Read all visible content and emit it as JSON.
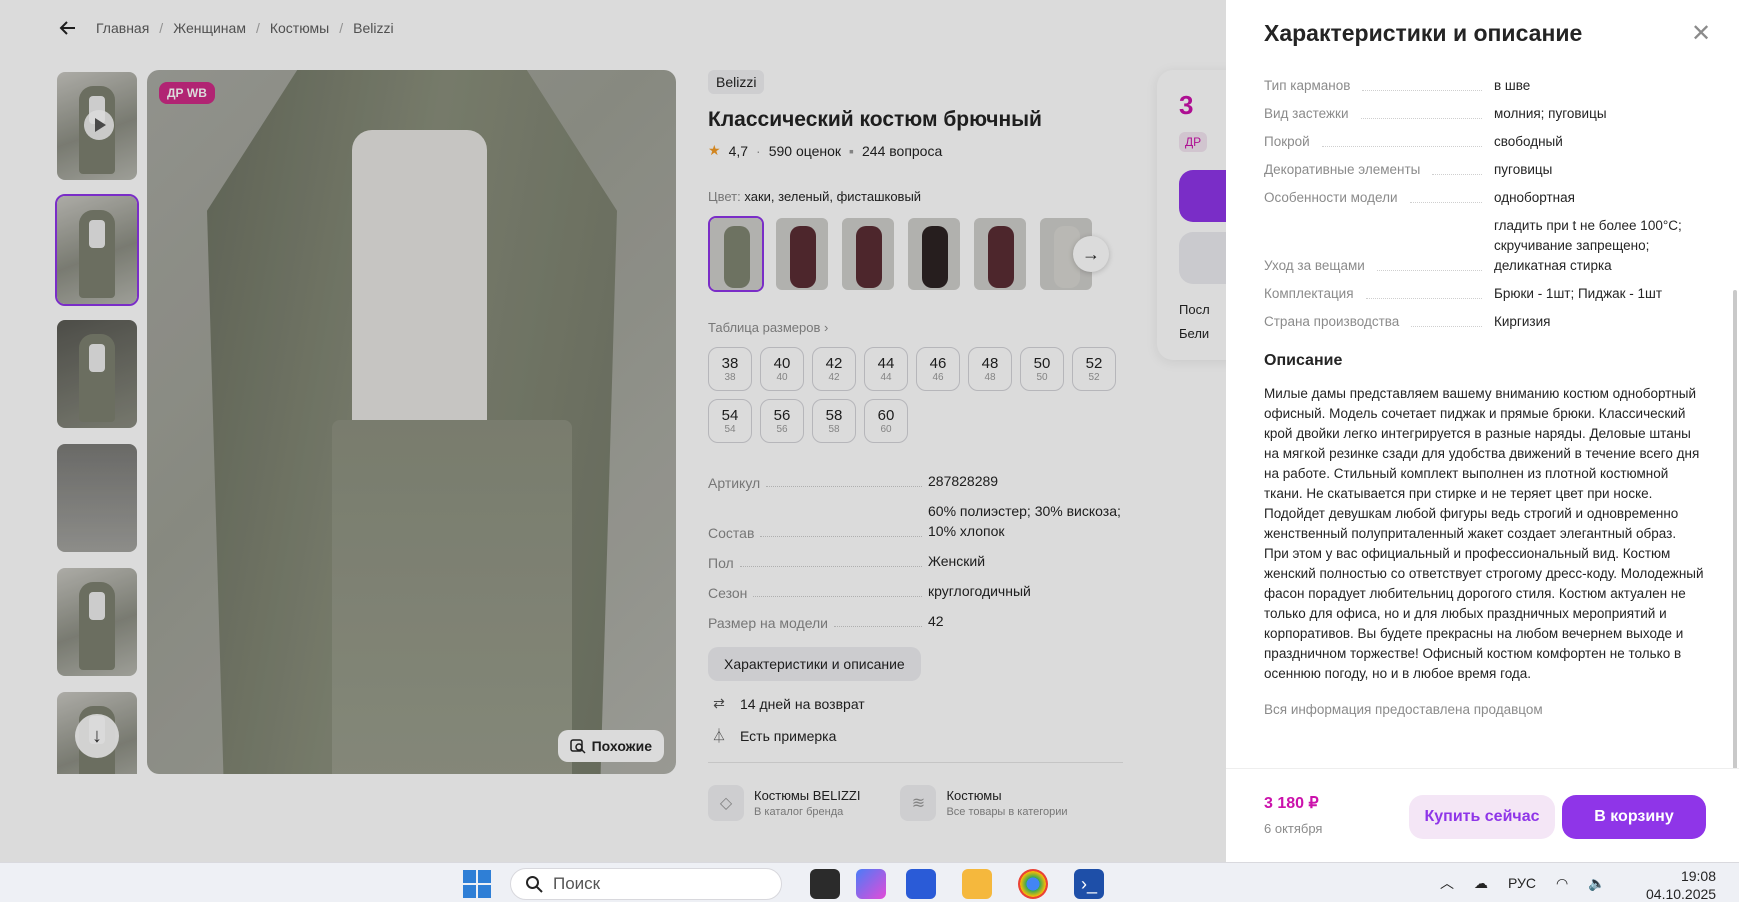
{
  "breadcrumb": [
    "Главная",
    "Женщинам",
    "Костюмы",
    "Belizzi"
  ],
  "gallery": {
    "badge": "ДР WB",
    "similar_label": "Похожие"
  },
  "product": {
    "brand": "Belizzi",
    "title": "Классический костюм брючный",
    "rating": "4,7",
    "reviews": "590 оценок",
    "questions": "244 вопроса",
    "color_label": "Цвет:",
    "color_value": "хаки, зеленый, фисташковый",
    "size_table_label": "Таблица размеров",
    "sizes": [
      {
        "n": "38",
        "s": "38"
      },
      {
        "n": "40",
        "s": "40"
      },
      {
        "n": "42",
        "s": "42"
      },
      {
        "n": "44",
        "s": "44"
      },
      {
        "n": "46",
        "s": "46"
      },
      {
        "n": "48",
        "s": "48"
      },
      {
        "n": "50",
        "s": "50"
      },
      {
        "n": "52",
        "s": "52"
      },
      {
        "n": "54",
        "s": "54"
      },
      {
        "n": "56",
        "s": "56"
      },
      {
        "n": "58",
        "s": "58"
      },
      {
        "n": "60",
        "s": "60"
      }
    ],
    "params": [
      {
        "k": "Артикул",
        "v": "287828289"
      },
      {
        "k": "Состав",
        "v": "60% полиэстер; 30% вискоза; 10% хлопок"
      },
      {
        "k": "Пол",
        "v": "Женский"
      },
      {
        "k": "Сезон",
        "v": "круглогодичный"
      },
      {
        "k": "Размер на модели",
        "v": "42"
      }
    ],
    "char_button": "Характеристики и описание",
    "return_info": "14 дней на возврат",
    "fitting_info": "Есть примерка",
    "links": [
      {
        "title": "Костюмы BELIZZI",
        "sub": "В каталог бренда"
      },
      {
        "title": "Костюмы",
        "sub": "Все товары в категории"
      }
    ]
  },
  "price_card": {
    "price": "3",
    "dr": "ДР",
    "line1": "Посл",
    "line2": "Бели"
  },
  "panel": {
    "title": "Характеристики и описание",
    "chars": [
      {
        "k": "Тип карманов",
        "v": "в шве"
      },
      {
        "k": "Вид застежки",
        "v": "молния; пуговицы"
      },
      {
        "k": "Покрой",
        "v": "свободный"
      },
      {
        "k": "Декоративные элементы",
        "v": "пуговицы"
      },
      {
        "k": "Особенности модели",
        "v": "однобортная"
      },
      {
        "k": "Уход за вещами",
        "v": "гладить при t не более 100°C; скручивание запрещено; деликатная стирка"
      },
      {
        "k": "Комплектация",
        "v": "Брюки - 1шт; Пиджак - 1шт"
      },
      {
        "k": "Страна производства",
        "v": "Киргизия"
      }
    ],
    "description_title": "Описание",
    "description": "Милые дамы представляем вашему вниманию костюм однобортный офисный. Модель сочетает пиджак и прямые брюки. Классический крой двойки легко интегрируется в разные наряды. Деловые штаны на мягкой резинке сзади для удобства движений в течение всего дня на работе. Стильный комплект выполнен из плотной костюмной ткани. Не скатывается при стирке и не теряет цвет при носке. Подойдет девушкам любой фигуры ведь строгий и одновременно женственный полуприталенный жакет создает элегантный образ. При этом у вас официальный и профессиональный вид. Костюм женский полностью со ответствует строгому дресс-коду. Молодежный фасон порадует любительниц дорогого стиля. Костюм актуален не только для офиса, но и для любых праздничных мероприятий и корпоративов. Вы будете прекрасны на любом вечернем выходе и праздничном торжестве! Офисный костюм комфортен не только в осеннюю погоду, но и в любое время года.",
    "note": "Вся информация предоставлена продавцом",
    "footer": {
      "price": "3 180 ₽",
      "date": "6 октября",
      "buy_label": "Купить сейчас",
      "cart_label": "В корзину"
    }
  },
  "taskbar": {
    "search_placeholder": "Поиск",
    "lang": "РУС",
    "time": "19:08",
    "date": "04.10.2025"
  }
}
